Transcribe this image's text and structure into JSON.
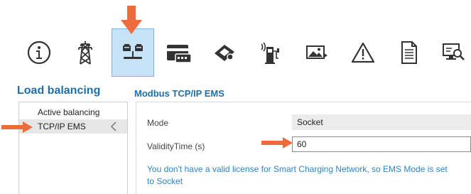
{
  "toolbar": {
    "items": [
      {
        "icon": "info-icon",
        "selected": false
      },
      {
        "icon": "power-pylon-icon",
        "selected": false
      },
      {
        "icon": "load-balancing-icon",
        "selected": true
      },
      {
        "icon": "payment-card-icon",
        "selected": false
      },
      {
        "icon": "card-reader-icon",
        "selected": false
      },
      {
        "icon": "charging-station-icon",
        "selected": false
      },
      {
        "icon": "image-icon",
        "selected": false
      },
      {
        "icon": "warning-icon",
        "selected": false
      },
      {
        "icon": "document-icon",
        "selected": false
      },
      {
        "icon": "monitor-search-icon",
        "selected": false
      }
    ]
  },
  "page": {
    "title": "Load balancing",
    "section_title": "Modbus TCP/IP EMS"
  },
  "sidebar": {
    "items": [
      {
        "label": "Active balancing",
        "active": false
      },
      {
        "label": "TCP/IP EMS",
        "active": true
      }
    ]
  },
  "form": {
    "mode_label": "Mode",
    "mode_value": "Socket",
    "validity_label": "ValidityTime (s)",
    "validity_value": "60"
  },
  "notice": "You don't have a valid license for Smart Charging Network, so EMS Mode is set to Socket",
  "colors": {
    "accent": "#1d6fa9",
    "highlight_arrow": "#ed6b3c",
    "notice_text": "#2b84c8",
    "selected_bg": "#c6e2f6"
  }
}
